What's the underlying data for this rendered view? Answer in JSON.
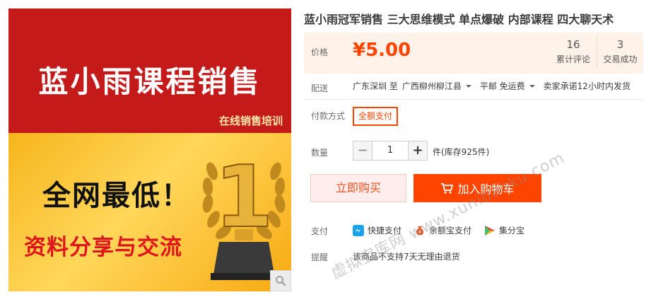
{
  "product_image": {
    "main_title": "蓝小雨课程销售",
    "sub_title": "在线销售培训",
    "big_text": "全网最低！",
    "red_text": "资料分享与交流",
    "trophy_number": "1",
    "zoom_icon": "magnifier-icon"
  },
  "title": "蓝小雨冠军销售 三大思维模式 单点爆破 内部课程 四大聊天术",
  "price": {
    "label": "价格",
    "value": "¥5.00",
    "reviews_count": "16",
    "reviews_label": "累计评论",
    "sales_count": "3",
    "sales_label": "交易成功"
  },
  "delivery": {
    "label": "配送",
    "from": "广东深圳 至",
    "to": "广西柳州柳江县",
    "shipping": "平邮 免运费",
    "promise": "卖家承诺12小时内发货"
  },
  "payment_method": {
    "label": "付款方式",
    "option": "全额支付"
  },
  "quantity": {
    "label": "数量",
    "minus": "−",
    "value": "1",
    "plus": "+",
    "stock": "件(库存925件)"
  },
  "actions": {
    "buy_now": "立即购买",
    "add_cart": "加入购物车"
  },
  "pay": {
    "label": "支付",
    "methods": [
      {
        "name": "快捷支付",
        "icon": "quickpay-icon"
      },
      {
        "name": "余额宝支付",
        "icon": "yuebao-icon"
      },
      {
        "name": "集分宝",
        "icon": "jifenbao-icon"
      }
    ]
  },
  "notice": {
    "label": "提醒",
    "text": "该商品不支持7天无理由退货"
  },
  "watermark": "虚拟宝库网 www.xunibaoku.com",
  "colors": {
    "accent": "#ff4400",
    "price": "#ff4400",
    "price_bg": "#fff2e8",
    "image_red": "#c41a1a",
    "image_gold": "#f6b51c"
  }
}
